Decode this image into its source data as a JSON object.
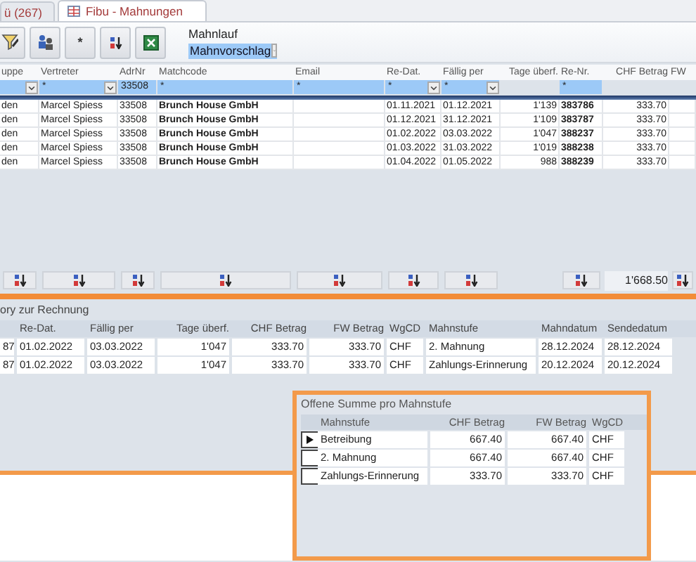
{
  "tabs": [
    {
      "label": "ü (267)",
      "selected": false
    },
    {
      "label": "Fibu - Mahnungen",
      "selected": true
    }
  ],
  "toolbar": {
    "asterisk_label": "*",
    "mahnlauf": {
      "label": "Mahnlauf",
      "value": "Mahnvorschlag"
    }
  },
  "main_table": {
    "columns": [
      {
        "label": "uppe",
        "sortable": true,
        "filter": {
          "kind": "dropdown"
        }
      },
      {
        "label": "Vertreter",
        "sortable": true,
        "filter": {
          "kind": "dropdown",
          "value": "*"
        }
      },
      {
        "label": "AdrNr",
        "sortable": true,
        "filter": {
          "kind": "text",
          "value": "33508"
        }
      },
      {
        "label": "Matchcode",
        "sortable": true,
        "filter": {
          "kind": "text",
          "value": "*"
        }
      },
      {
        "label": "Email",
        "sortable": true,
        "filter": {
          "kind": "text",
          "value": "*"
        }
      },
      {
        "label": "Re-Dat.",
        "sortable": true,
        "filter": {
          "kind": "dropdown",
          "value": "*"
        }
      },
      {
        "label": "Fällig per",
        "sortable": true,
        "filter": {
          "kind": "dropdown",
          "value": "*"
        }
      },
      {
        "label": "Tage überf.",
        "sortable": false,
        "filter": {
          "kind": "none"
        }
      },
      {
        "label": "Re-Nr.",
        "sortable": true,
        "filter": {
          "kind": "text",
          "value": "*"
        }
      },
      {
        "label": "CHF Betrag",
        "sortable": false,
        "filter": {
          "kind": "none"
        }
      },
      {
        "label": "FW",
        "sortable": true,
        "filter": {
          "kind": "none"
        }
      }
    ],
    "rows": [
      [
        "den",
        "Marcel Spiess",
        "33508",
        "Brunch House GmbH",
        null,
        "01.11.2021",
        "01.12.2021",
        "1'139",
        "383786",
        "333.70",
        null
      ],
      [
        "den",
        "Marcel Spiess",
        "33508",
        "Brunch House GmbH",
        null,
        "01.12.2021",
        "31.12.2021",
        "1'109",
        "383787",
        "333.70",
        null
      ],
      [
        "den",
        "Marcel Spiess",
        "33508",
        "Brunch House GmbH",
        null,
        "01.02.2022",
        "03.03.2022",
        "1'047",
        "388237",
        "333.70",
        null
      ],
      [
        "den",
        "Marcel Spiess",
        "33508",
        "Brunch House GmbH",
        null,
        "01.03.2022",
        "31.03.2022",
        "1'019",
        "388238",
        "333.70",
        null
      ],
      [
        "den",
        "Marcel Spiess",
        "33508",
        "Brunch House GmbH",
        null,
        "01.04.2022",
        "01.05.2022",
        "988",
        "388239",
        "333.70",
        null
      ]
    ],
    "total": "1'668.50"
  },
  "history": {
    "title": "ory zur Rechnung",
    "columns": [
      "Re-Dat.",
      "Fällig per",
      "Tage überf.",
      "CHF Betrag",
      "FW Betrag",
      "WgCD",
      "Mahnstufe",
      "Mahndatum",
      "Sendedatum"
    ],
    "rows": [
      {
        "column_1": "87",
        "cells": [
          "01.02.2022",
          "03.03.2022",
          "1'047",
          "333.70",
          "333.70",
          "CHF",
          "2. Mahnung",
          "28.12.2024",
          "28.12.2024"
        ]
      },
      {
        "column_1": "87",
        "cells": [
          "01.02.2022",
          "03.03.2022",
          "1'047",
          "333.70",
          "333.70",
          "CHF",
          "Zahlungs-Erinnerung",
          "20.12.2024",
          "20.12.2024"
        ]
      }
    ]
  },
  "summary": {
    "title": "Offene Summe pro Mahnstufe",
    "columns": [
      "Mahnstufe",
      "CHF Betrag",
      "FW Betrag",
      "WgCD"
    ],
    "rows": [
      {
        "selected": true,
        "cells": [
          "Betreibung",
          "667.40",
          "667.40",
          "CHF"
        ]
      },
      {
        "selected": false,
        "cells": [
          "2. Mahnung",
          "667.40",
          "667.40",
          "CHF"
        ]
      },
      {
        "selected": false,
        "cells": [
          "Zahlungs-Erinnerung",
          "333.70",
          "333.70",
          "CHF"
        ]
      }
    ]
  }
}
